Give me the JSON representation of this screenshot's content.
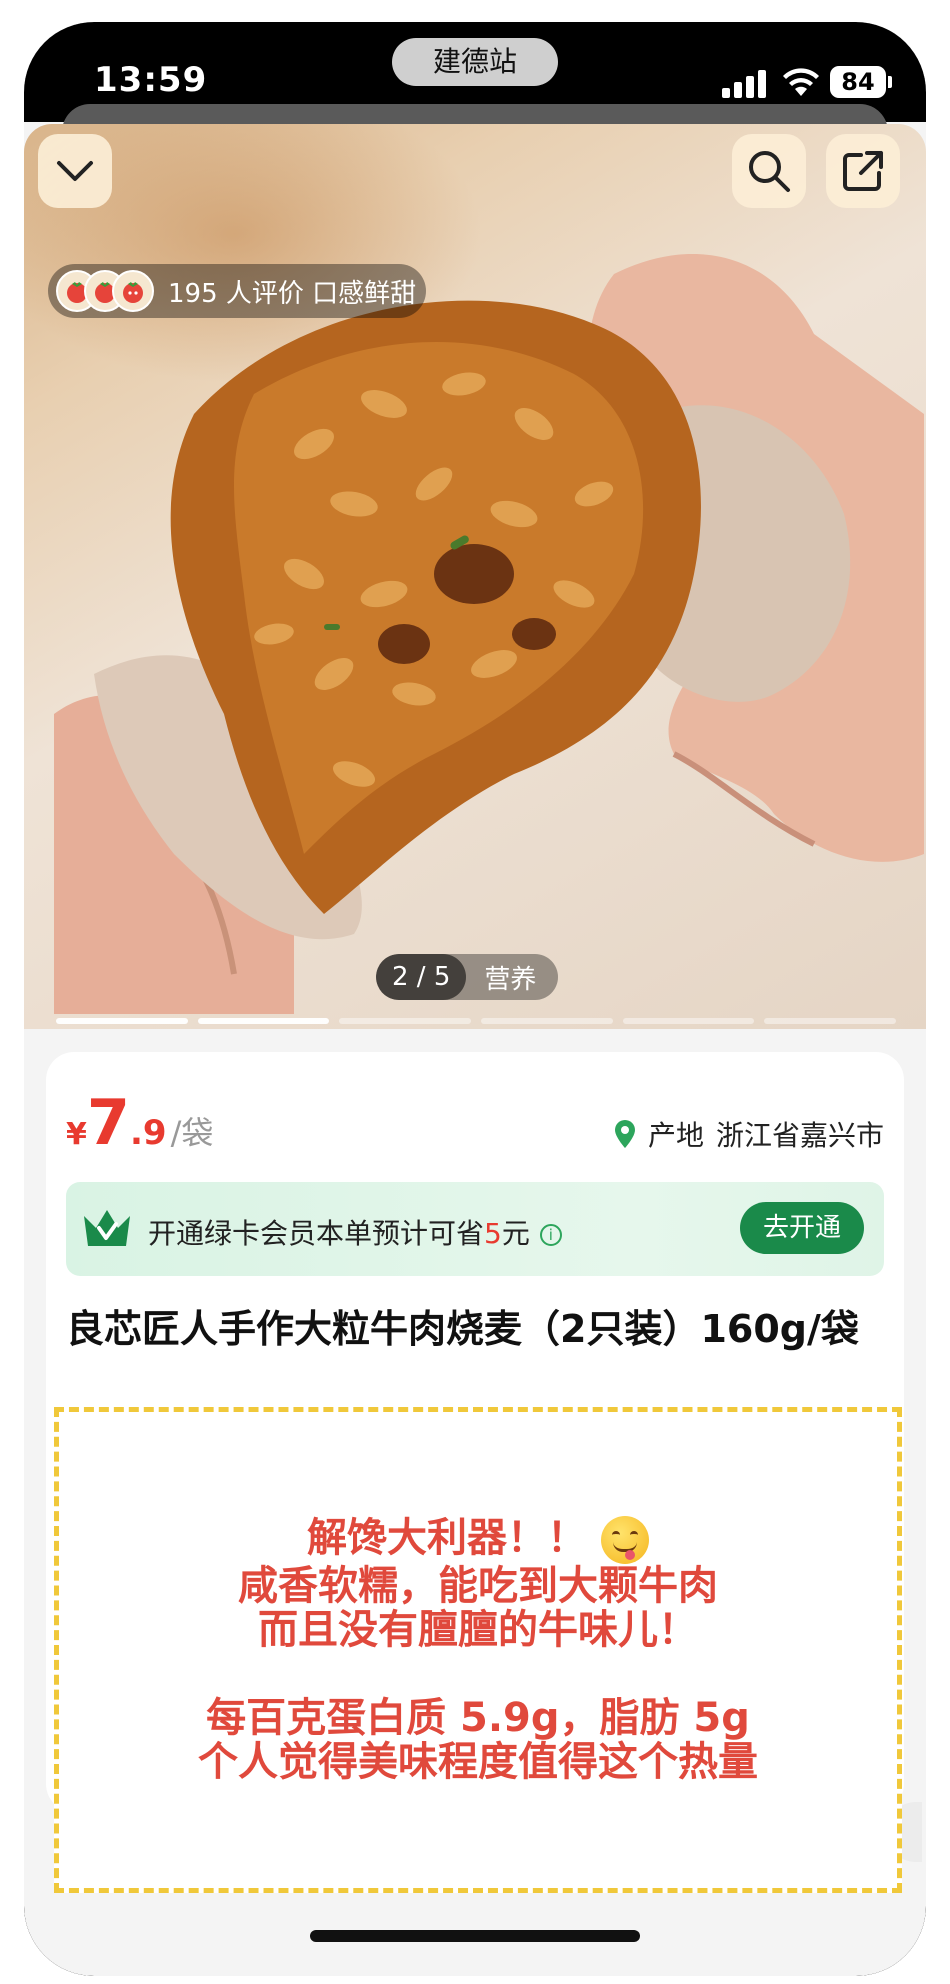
{
  "status_bar": {
    "time": "13:59",
    "island_label": "建德站",
    "battery": "84"
  },
  "hero": {
    "rating_text": "195 人评价 口感鲜甜",
    "page_indicator": "2 / 5",
    "tab_label": "营养",
    "slide_count": 6,
    "active_slide": 2
  },
  "price": {
    "currency": "¥",
    "integer": "7",
    "decimal": ".9",
    "unit": "/袋"
  },
  "origin": {
    "label": "产地",
    "value": "浙江省嘉兴市"
  },
  "membership": {
    "text_before": "开通绿卡会员本单预计可省",
    "amount": "5",
    "text_after": "元",
    "info_icon": "i",
    "button": "去开通"
  },
  "product": {
    "title": "良芯匠人手作大粒牛肉烧麦（2只装）160g/袋"
  },
  "note": {
    "line1": "解馋大利器！！",
    "line2": "咸香软糯，能吃到大颗牛肉",
    "line3": "而且没有膻膻的牛味儿！",
    "line4": "每百克蛋白质 5.9g，脂肪 5g",
    "line5": "个人觉得美味程度值得这个热量"
  },
  "icons": {
    "collapse": "chevron-down-icon",
    "search": "search-icon",
    "share": "share-icon",
    "location": "location-pin-icon",
    "crown": "member-crown-icon"
  },
  "colors": {
    "price_red": "#e83a2f",
    "member_green": "#1a8a4a",
    "note_border": "#f0c83a"
  }
}
